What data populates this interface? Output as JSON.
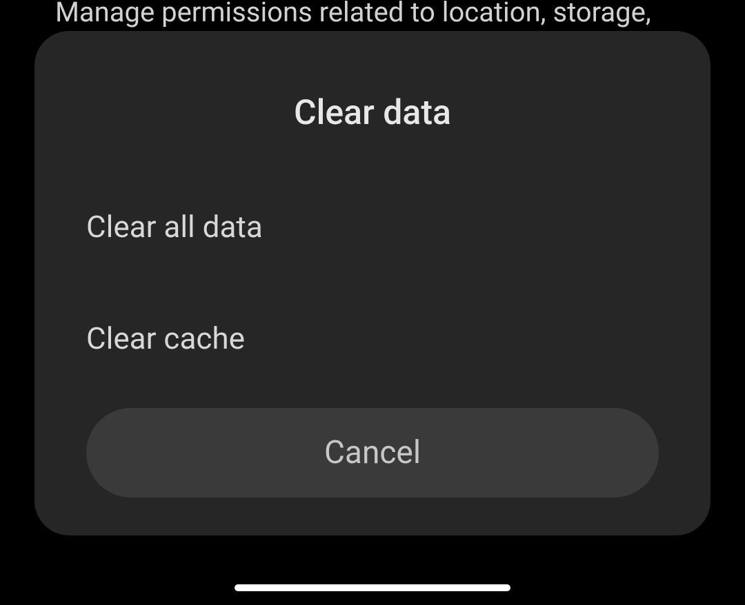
{
  "background": {
    "permissions_text": "Manage permissions related to location, storage, phone, messages, and contacts"
  },
  "dialog": {
    "title": "Clear data",
    "options": [
      {
        "label": "Clear all data"
      },
      {
        "label": "Clear cache"
      }
    ],
    "cancel_label": "Cancel"
  }
}
